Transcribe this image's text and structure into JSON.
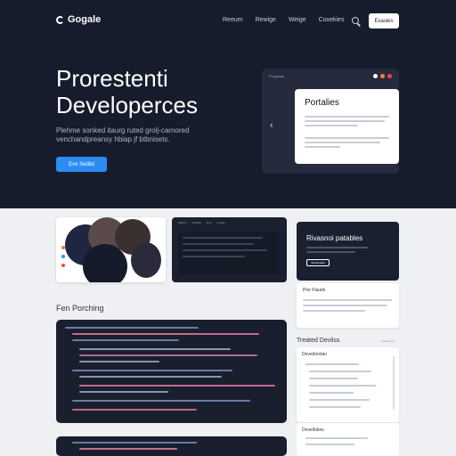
{
  "brand": {
    "name": "Gogale"
  },
  "nav": {
    "links": [
      "Reeum",
      "Rewige",
      "Weige",
      "Coxekies"
    ],
    "button": "Exasies"
  },
  "hero": {
    "title_line1": "Prorestenti",
    "title_line2": "Developerces",
    "subtitle": "Plehme sonked itaurg ruted grolj-carnored venchandpreansy hbiap jf btbnisets.",
    "cta": "Eve Sedlid"
  },
  "showcase": {
    "label": "Proqpsas",
    "card_title": "Portalies",
    "dot_colors": [
      "#ffffff",
      "#ff7a3d",
      "#ff3d3d"
    ]
  },
  "panel_tabs": [
    "Mescof",
    "Dexidle",
    "Iomi",
    "Lopliss"
  ],
  "feature": {
    "title": "Rivasnoi patables",
    "button": "Nrotemaleo"
  },
  "section": {
    "title": "Fen Porching"
  },
  "info_card": {
    "title": "Pior Flauds"
  },
  "sidebar": {
    "title": "Treated Devliss",
    "meta": "Treaks ansh",
    "panel_title": "Devedsrolan",
    "panel2_title": "Devellobes"
  },
  "colors": {
    "hero_bg": "#171c2d",
    "accent": "#2d8cf0",
    "code_bg": "#1a1f2e"
  }
}
